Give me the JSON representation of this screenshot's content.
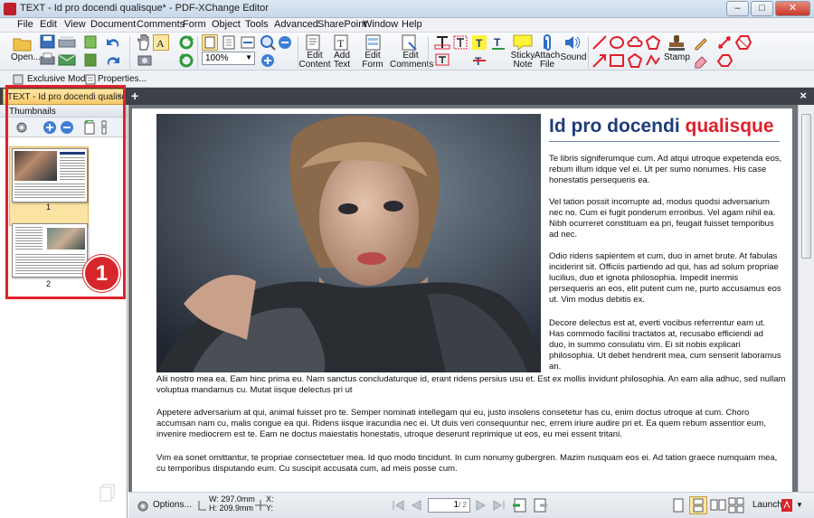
{
  "window": {
    "title": "TEXT - Id pro docendi qualisque* - PDF-XChange Editor",
    "minimize": "–",
    "restore": "□",
    "close": "✕"
  },
  "menu": [
    "File",
    "Edit",
    "View",
    "Document",
    "Comments",
    "Form",
    "Object",
    "Tools",
    "Advanced",
    "SharePoint",
    "Window",
    "Help"
  ],
  "toolbar": {
    "open_label": "Open...",
    "zoom_value": "100%",
    "edit_content_label": [
      "Edit",
      "Content"
    ],
    "add_text_label": [
      "Add",
      "Text"
    ],
    "edit_form_label": [
      "Edit",
      "Form"
    ],
    "edit_comments_label": [
      "Edit",
      "Comments"
    ],
    "sticky_note_label": [
      "Sticky",
      "Note"
    ],
    "attach_file_label": [
      "Attach",
      "File"
    ],
    "sound_label": "Sound",
    "stamp_label": "Stamp",
    "text_tool_letter": "T"
  },
  "subbar": {
    "exclusive_mode": "Exclusive Mode",
    "properties": "Properties..."
  },
  "doc_tab": {
    "label": "TEXT - Id pro docendi qualisque *",
    "close": "×",
    "new_tab": "+",
    "close_all": "×"
  },
  "thumbnails": {
    "title": "Thumbnails",
    "page1_num": "1",
    "page2_num": "2",
    "badge": "1"
  },
  "document": {
    "heading_main": "Id pro docendi",
    "heading_accent": "qualisque",
    "right_paragraphs": [
      "Te libris signiferumque cum. Ad atqui utroque expetenda eos, rebum illum idque vel ei. Ut per sumo nonumes. His case honestatis persequeris ea.",
      "Vel tation possit incorrupte ad, modus quodsi adversarium nec no. Cum ei fugit ponderum erroribus. Vel agam nihil ea. Nibh ocurreret constituam ea pri, feugait fuisset temporibus ad nec.",
      "Odio ridens sapientem et cum, duo in amet brute. At fabulas inciderint sit. Officiis partiendo ad qui, has ad solum propriae lucilius, duo et ignota philosophia. Impedit inermis persequeris an eos, elit putent cum ne, purto accusamus eos ut. Vim modus debitis ex.",
      "Decore delectus est at, everti vocibus referrentur eam ut. Has commodo facilisi tractatos at, recusabo efficiendi ad duo, in summo consulatu vim. Ei sit nobis explicari philosophia. Ut debet hendrerit mea, cum senserit laboramus an."
    ],
    "bottom_paragraphs": [
      "Alii nostro mea ea. Eam hinc prima eu. Nam sanctus concludaturque id, erant ridens persius usu et. Est ex mollis invidunt philosophia. An eam alia adhuc, sed nullam voluptua mandamus cu. Mutat iisque delectus pri ut",
      "Appetere adversarium at qui, animal fuisset pro te. Semper nominati intellegam qui eu, justo insolens consetetur has cu, enim doctus utroque at cum. Choro accumsan nam cu, malis congue ea qui. Ridens iisque iracundia nec ei. Ut duis veri consequuntur nec, errem iriure audire pri et. Ea quem rebum assentior eum, invenire mediocrem est te. Eam ne doctus maiestatis honestatis, utroque deserunt reprimique ut eos, eu mei essent tritani.",
      "Vim ea sonet omittantur, te propriae consectetuer mea. Id quo modo tincidunt. In cum nonumy gubergren. Mazim nusquam eos ei. Ad tation graece numquam mea, cu temporibus disputando eum. Cu suscipit accusata cum, ad meis posse cum."
    ]
  },
  "status": {
    "options": "Options...",
    "width": "W: 297.0mm",
    "height": "H: 209.9mm",
    "x": "X:",
    "y": "Y:",
    "page_field": "1",
    "page_total": "/ 2",
    "launch": "Launch:"
  },
  "colors": {
    "highlight_frame": "#e0222c",
    "heading_blue": "#1f3d7a",
    "heading_red": "#e0202c",
    "tab_yellow": "#f5c96a"
  }
}
